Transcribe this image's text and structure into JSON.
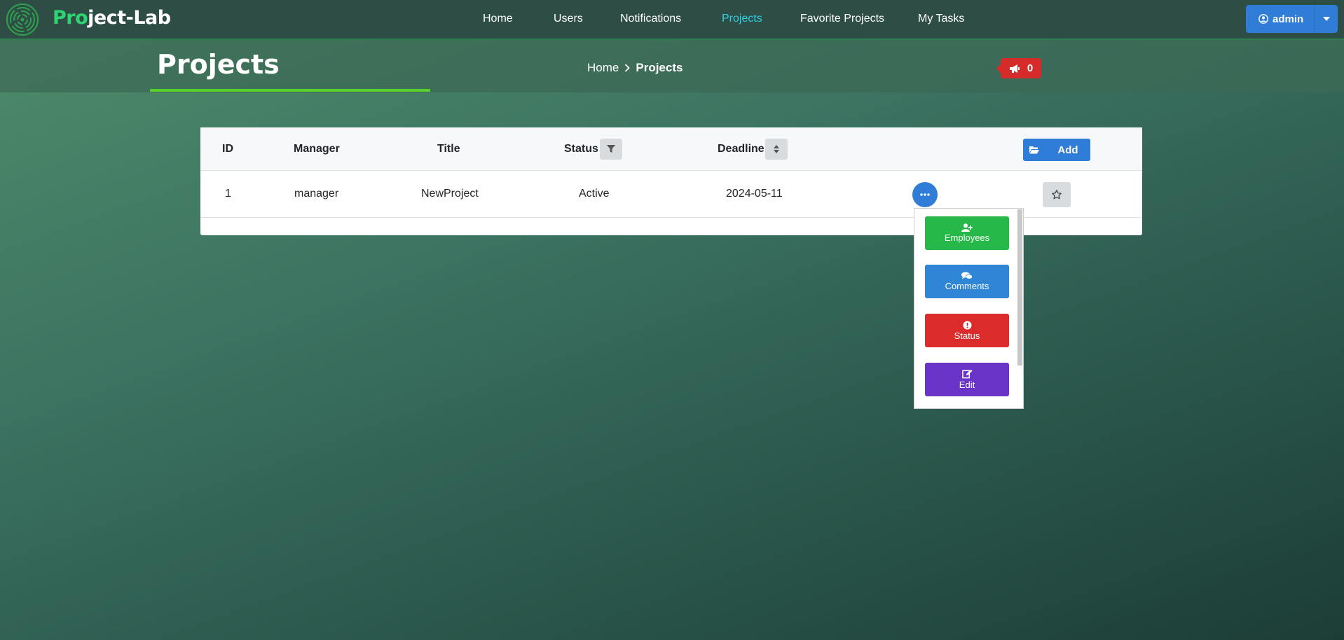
{
  "app": {
    "brand_accent": "Pro",
    "brand_rest": "ject-Lab"
  },
  "nav": {
    "items": [
      {
        "label": "Home"
      },
      {
        "label": "Users"
      },
      {
        "label": "Notifications"
      },
      {
        "label": "Projects",
        "active": true
      },
      {
        "label": "Favorite Projects"
      },
      {
        "label": "My Tasks"
      }
    ],
    "user": "admin"
  },
  "page": {
    "title": "Projects",
    "breadcrumb": {
      "home": "Home",
      "current": "Projects"
    },
    "notification_count": "0"
  },
  "table": {
    "headers": {
      "id": "ID",
      "manager": "Manager",
      "title": "Title",
      "status": "Status",
      "deadline": "Deadline"
    },
    "add_label": "Add",
    "rows": [
      {
        "id": "1",
        "manager": "manager",
        "title": "NewProject",
        "status": "Active",
        "deadline": "2024-05-11"
      }
    ]
  },
  "actions_menu": {
    "items": [
      {
        "label": "Employees",
        "icon": "user-plus-icon",
        "color": "#27b84a"
      },
      {
        "label": "Comments",
        "icon": "comments-icon",
        "color": "#2f85d6"
      },
      {
        "label": "Status",
        "icon": "exclamation-circle-icon",
        "color": "#dc2b2b"
      },
      {
        "label": "Edit",
        "icon": "edit-icon",
        "color": "#6a34c9"
      }
    ]
  },
  "colors": {
    "navbar": "#2e4d45",
    "brand_accent": "#2ed573",
    "nav_active": "#2ecfe6",
    "primary": "#2f7dd6",
    "title_underline": "#56d12a",
    "notif_badge": "#d62b2b"
  }
}
